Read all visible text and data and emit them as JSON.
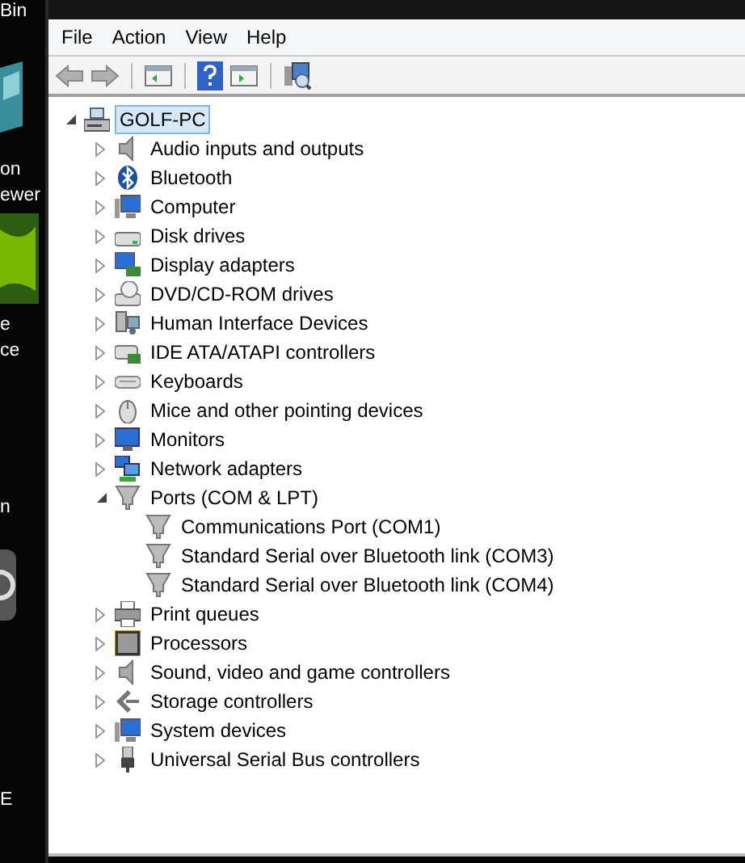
{
  "desktop": {
    "labels": [
      "Bin",
      "on",
      "ewer",
      "e",
      "ce",
      "n",
      "E"
    ]
  },
  "menu": [
    "File",
    "Action",
    "View",
    "Help"
  ],
  "tree": {
    "label": "GOLF-PC",
    "expanded": true,
    "selected": true,
    "children": [
      {
        "label": "Audio inputs and outputs",
        "expanded": false,
        "selected": false
      },
      {
        "label": "Bluetooth",
        "expanded": false,
        "selected": false
      },
      {
        "label": "Computer",
        "expanded": false,
        "selected": false
      },
      {
        "label": "Disk drives",
        "expanded": false,
        "selected": false
      },
      {
        "label": "Display adapters",
        "expanded": false,
        "selected": false
      },
      {
        "label": "DVD/CD-ROM drives",
        "expanded": false,
        "selected": false
      },
      {
        "label": "Human Interface Devices",
        "expanded": false,
        "selected": false
      },
      {
        "label": "IDE ATA/ATAPI controllers",
        "expanded": false,
        "selected": false
      },
      {
        "label": "Keyboards",
        "expanded": false,
        "selected": false
      },
      {
        "label": "Mice and other pointing devices",
        "expanded": false,
        "selected": false
      },
      {
        "label": "Monitors",
        "expanded": false,
        "selected": false
      },
      {
        "label": "Network adapters",
        "expanded": false,
        "selected": false
      },
      {
        "label": "Ports (COM & LPT)",
        "expanded": true,
        "selected": false,
        "children": [
          {
            "label": "Communications Port (COM1)",
            "selected": false
          },
          {
            "label": "Standard Serial over Bluetooth link (COM3)",
            "selected": false
          },
          {
            "label": "Standard Serial over Bluetooth link (COM4)",
            "selected": false
          }
        ]
      },
      {
        "label": "Print queues",
        "expanded": false,
        "selected": false
      },
      {
        "label": "Processors",
        "expanded": false,
        "selected": false
      },
      {
        "label": "Sound, video and game controllers",
        "expanded": false,
        "selected": false
      },
      {
        "label": "Storage controllers",
        "expanded": false,
        "selected": false
      },
      {
        "label": "System devices",
        "expanded": false,
        "selected": false
      },
      {
        "label": "Universal Serial Bus controllers",
        "expanded": false,
        "selected": false
      }
    ]
  }
}
